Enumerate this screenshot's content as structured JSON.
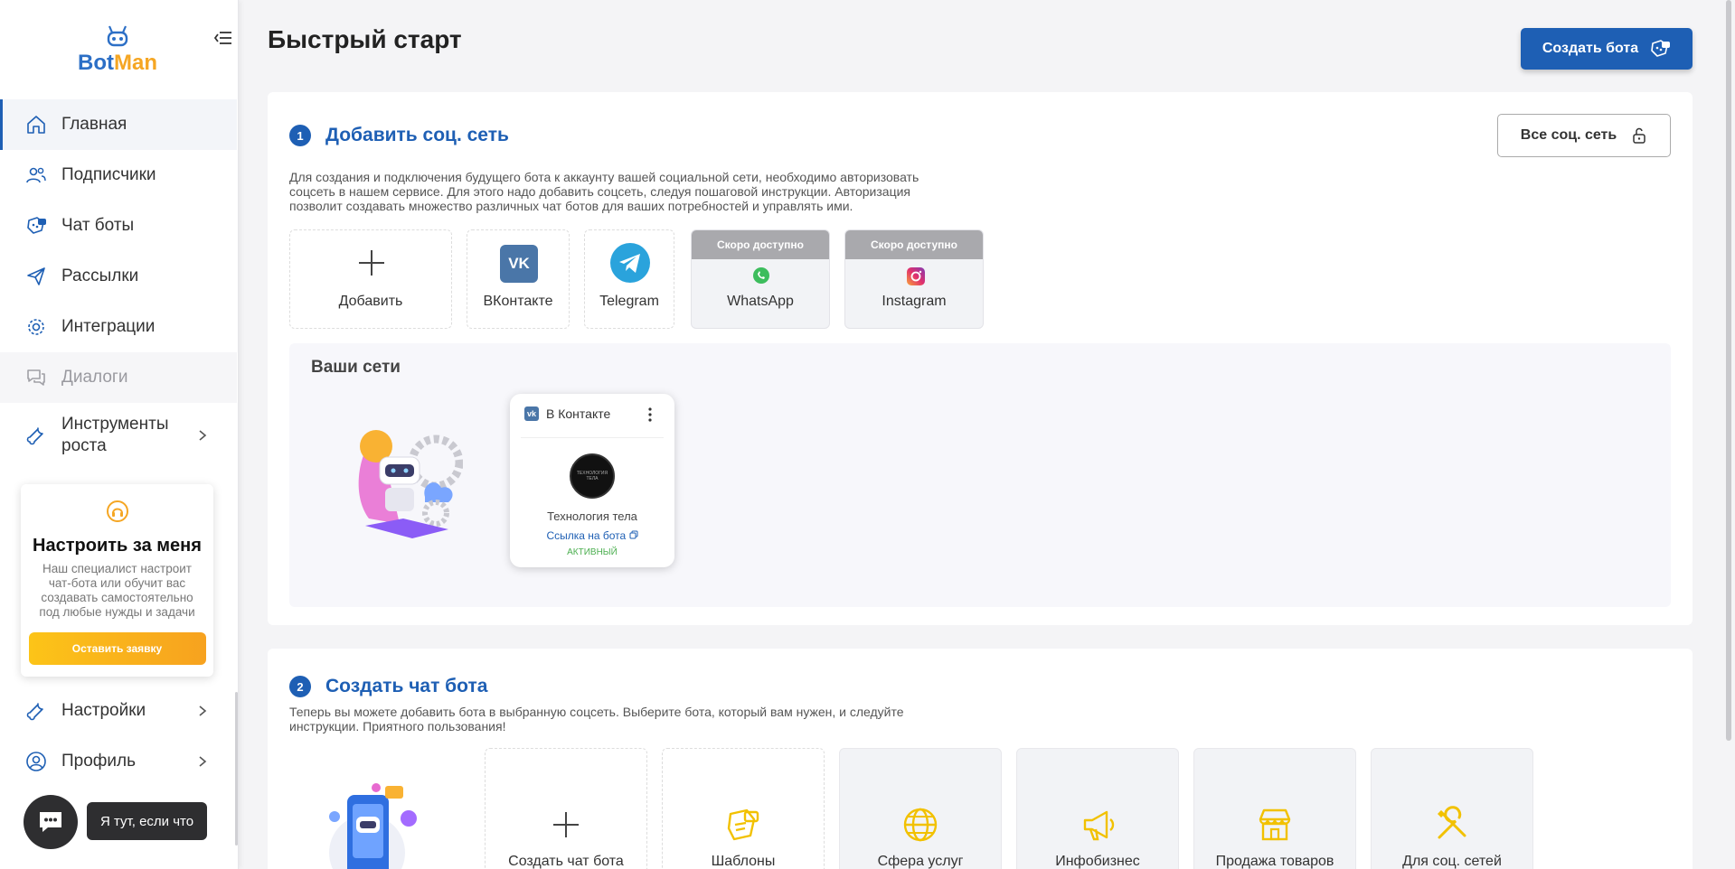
{
  "app": {
    "logo_bot": "Bot",
    "logo_man": "Man",
    "brand_blue": "#1e5fb4",
    "brand_orange": "#f5a623"
  },
  "sidebar": {
    "items": [
      {
        "label": "Главная",
        "icon": "home-icon",
        "active": true
      },
      {
        "label": "Подписчики",
        "icon": "users-icon"
      },
      {
        "label": "Чат боты",
        "icon": "chatbot-icon"
      },
      {
        "label": "Рассылки",
        "icon": "send-icon"
      },
      {
        "label": "Интеграции",
        "icon": "gear-icon"
      },
      {
        "label": "Диалоги",
        "icon": "dialogs-icon",
        "dimmed": true
      },
      {
        "label": "Инструменты роста",
        "icon": "wrench-icon",
        "expandable": true
      }
    ],
    "promo": {
      "title": "Настроить за меня",
      "text": "Наш специалист настроит чат-бота или обучит вас создавать самостоятельно под любые нужды и задачи",
      "button": "Оставить заявку"
    },
    "items2": [
      {
        "label": "Настройки",
        "icon": "wrench-icon",
        "expandable": true
      },
      {
        "label": "Профиль",
        "icon": "user-icon",
        "expandable": true
      }
    ],
    "chat_tip": "Я тут, если что"
  },
  "header": {
    "title": "Быстрый старт",
    "create_button": "Создать бота"
  },
  "step1": {
    "number": "1",
    "title": "Добавить соц. сеть",
    "description_lines": [
      "Для создания и подключения будущего бота к аккаунту вашей социальной сети, необходимо авторизовать",
      "соцсеть в нашем сервисе. Для этого надо добавить соцсеть, следуя пошаговой инструкции. Авторизация",
      "позволит создавать множество различных чат ботов для ваших потребностей и управлять ими."
    ],
    "all_networks_button": "Все соц. сеть",
    "tiles": [
      {
        "label": "Добавить",
        "icon": "plus-icon"
      },
      {
        "label": "ВКонтакте",
        "icon": "vk-icon"
      },
      {
        "label": "Telegram",
        "icon": "telegram-icon"
      },
      {
        "label": "WhatsApp",
        "icon": "whatsapp-icon",
        "badge": "Скоро доступно"
      },
      {
        "label": "Instagram",
        "icon": "instagram-icon",
        "badge": "Скоро доступно"
      }
    ],
    "your_networks": {
      "title": "Ваши сети",
      "card": {
        "network": "В Контакте",
        "avatar_text": "ТЕХНОЛОГИЯ ТЕЛА",
        "name": "Технология тела",
        "link": "Ссылка на бота",
        "status": "АКТИВНЫЙ"
      }
    }
  },
  "step2": {
    "number": "2",
    "title": "Создать чат бота",
    "description_lines": [
      "Теперь вы можете добавить бота в выбранную соцсеть. Выберите бота, который вам нужен, и следуйте",
      "инструкции. Приятного пользования!"
    ],
    "tiles": [
      {
        "label": "Создать чат бота",
        "icon": "plus-icon"
      },
      {
        "label": "Шаблоны",
        "icon": "templates-icon"
      },
      {
        "label": "Сфера услуг",
        "icon": "globe-icon"
      },
      {
        "label": "Инфобизнес",
        "icon": "megaphone-icon"
      },
      {
        "label": "Продажа товаров",
        "icon": "shop-icon"
      },
      {
        "label": "Для соц. сетей",
        "icon": "tools-icon"
      }
    ]
  }
}
